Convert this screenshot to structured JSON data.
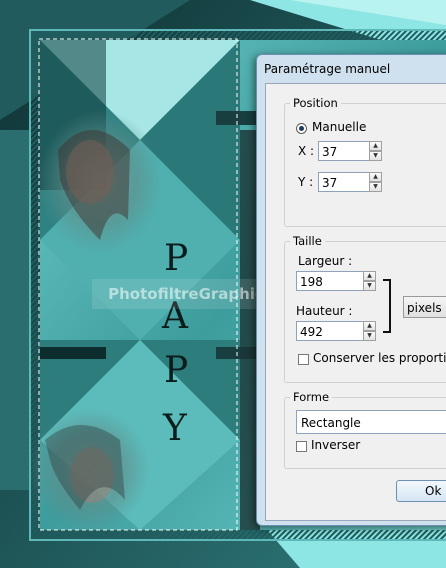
{
  "watermark": "PhotofiltreGraphic",
  "canvas_title_letters": [
    "P",
    "A",
    "P",
    "Y"
  ],
  "dialog": {
    "title": "Paramétrage manuel",
    "position": {
      "legend": "Position",
      "radio_label": "Manuelle",
      "x_label": "X :",
      "x_value": "37",
      "y_label": "Y :",
      "y_value": "37"
    },
    "taille": {
      "legend": "Taille",
      "largeur_label": "Largeur :",
      "largeur_value": "198",
      "hauteur_label": "Hauteur :",
      "hauteur_value": "492",
      "unit_value": "pixels",
      "proportions_label": "Conserver les proportions"
    },
    "forme": {
      "legend": "Forme",
      "shape_value": "Rectangle",
      "inverser_label": "Inverser"
    },
    "ok_label": "Ok"
  }
}
